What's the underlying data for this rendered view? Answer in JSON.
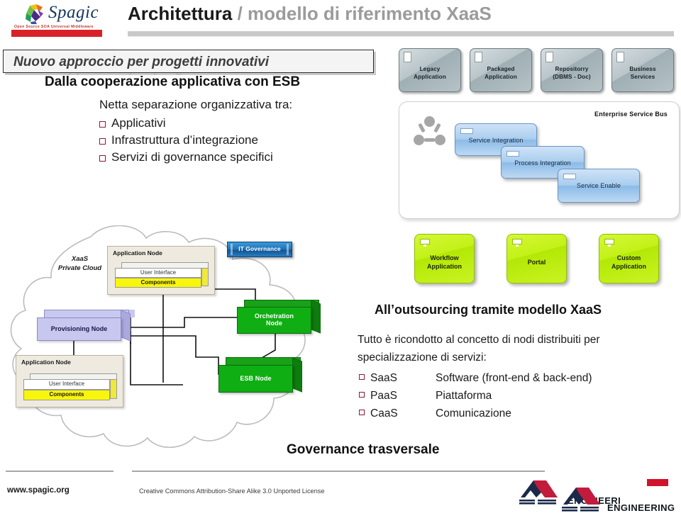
{
  "brand": {
    "name": "Spagic",
    "tagline": "Open Source SOA Universal Middleware",
    "accent_red": "#d8222a",
    "word_color": "#15355f"
  },
  "header": {
    "title_strong": "Architettura",
    "title_separator": " / ",
    "title_light": "modello di riferimento XaaS"
  },
  "banner": {
    "text": "Nuovo approccio per progetti innovativi",
    "ghost_text": "Nuovo approccio per progetti innovativi"
  },
  "left_text": {
    "lead": "Dalla cooperazione applicativa con ESB",
    "sub_lead": "Netta separazione organizzativa tra:",
    "bullets": [
      "Applicativi",
      "Infrastruttura d’integrazione",
      "Servizi di governance specifici"
    ]
  },
  "right_text": {
    "title": "All’outsourcing tramite modello XaaS",
    "paragraph": "Tutto è ricondotto al concetto di nodi distribuiti per specializzazione di servizi:",
    "items": [
      {
        "key": "SaaS",
        "value": "Software (front-end & back-end)"
      },
      {
        "key": "PaaS",
        "value": "Piattaforma"
      },
      {
        "key": "CaaS",
        "value": "Comunicazione"
      }
    ],
    "footer_line": "Governance trasversale"
  },
  "esb_diagram": {
    "applications": [
      {
        "line1": "Legacy",
        "line2": "Application"
      },
      {
        "line1": "Packaged",
        "line2": "Application"
      },
      {
        "line1": "Repositorry",
        "line2": "(DBMS - Doc)"
      },
      {
        "line1": "Business",
        "line2": "Services"
      }
    ],
    "panel_title": "Enterprise Service Bus",
    "layers": [
      "Service Integration",
      "Process Integration",
      "Service Enable"
    ],
    "icon": "network-nodes-icon"
  },
  "cloud_diagram": {
    "cloud_label_line1": "XaaS",
    "cloud_label_line2": "Private Cloud",
    "it_governance": "IT Governance",
    "application_node_label": "Application Node",
    "stack_user_interface": "User Interface",
    "stack_components": "Components",
    "provisioning_node": "Provisioning Node",
    "orchestration_node_line1": "Orchetration",
    "orchestration_node_line2": "Node",
    "esb_node": "ESB Node",
    "green": "#0fae13",
    "purple": "#c8c7ef",
    "yellow": "#f8f60a",
    "blue": "#1f6fb5"
  },
  "green_tiles": [
    {
      "line1": "Workflow",
      "line2": "Application"
    },
    {
      "line1": "Portal",
      "line2": ""
    },
    {
      "line1": "Custom",
      "line2": "Application"
    }
  ],
  "footer": {
    "url": "www.spagic.org",
    "license": "Creative Commons Attribution-Share Alike 3.0 Unported License",
    "engineering_label_1": "ENGINEERI",
    "engineering_label_2": "ENGINEERING"
  }
}
